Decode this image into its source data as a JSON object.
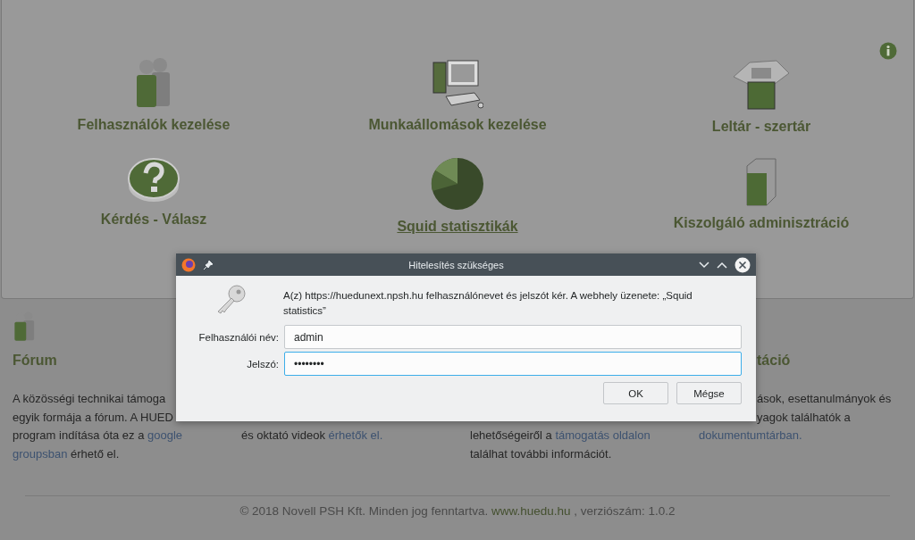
{
  "tiles": [
    {
      "label": "Felhasználók kezelése",
      "kind": "users",
      "underlined": false
    },
    {
      "label": "Munkaállomások kezelése",
      "kind": "computer",
      "underlined": false
    },
    {
      "label": "Leltár - szertár",
      "kind": "box",
      "underlined": false
    },
    {
      "label": "Kérdés - Válasz",
      "kind": "question",
      "underlined": false
    },
    {
      "label": "Squid statisztikák",
      "kind": "pie",
      "underlined": true
    },
    {
      "label": "Kiszolgáló adminisztráció",
      "kind": "server",
      "underlined": false
    }
  ],
  "sections": [
    {
      "title": "Fórum",
      "title_clipped": false,
      "kind": "users",
      "lines": [
        {
          "clipped_start": false,
          "segments": [
            {
              "text": "A közösségi technikai támoga",
              "link": false
            }
          ]
        },
        {
          "clipped_start": false,
          "segments": [
            {
              "text": "egyik formája a fórum. A HUED",
              "link": false
            }
          ]
        },
        {
          "clipped_start": false,
          "segments": [
            {
              "text": "program indítása óta ez a ",
              "link": false
            },
            {
              "text": "google",
              "link": true
            }
          ]
        },
        {
          "clipped_start": false,
          "segments": [
            {
              "text": "groupsban",
              "link": true
            },
            {
              "text": " érhető el.",
              "link": false
            }
          ]
        }
      ]
    },
    {
      "lines": [
        {
          "segments": [
            {
              "text": "és oktató videok ",
              "link": false
            },
            {
              "text": "érhetők el.",
              "link": true
            }
          ]
        }
      ]
    },
    {
      "lines": [
        {
          "segments": [
            {
              "text": "lehetőségeiről a ",
              "link": false
            },
            {
              "text": "támogatás oldalon",
              "link": true
            }
          ]
        },
        {
          "segments": [
            {
              "text": "találhat további információt.",
              "link": false
            }
          ]
        }
      ]
    },
    {
      "title": "táció",
      "title_clipped": true,
      "lines": [
        {
          "clipped_start": true,
          "segments": [
            {
              "text": "ások, esettanulmányok és",
              "link": false
            }
          ]
        },
        {
          "clipped_start": true,
          "segments": [
            {
              "text": "yagok találhatók a",
              "link": false
            }
          ]
        },
        {
          "clipped_start": false,
          "segments": [
            {
              "text": "dokumentumtárban.",
              "link": true
            }
          ]
        }
      ]
    }
  ],
  "footer": {
    "text": "© 2018 Novell PSH Kft. Minden jog fenntartva. ",
    "link": "www.huedu.hu",
    "suffix": " , verziószám: 1.0.2"
  },
  "dialog": {
    "title": "Hitelesítés szükséges",
    "message": "A(z) https://huedunext.npsh.hu felhasználónevet és jelszót kér. A webhely üzenete: „Squid statistics”",
    "fields": [
      {
        "label": "Felhasználói név:",
        "value": "admin",
        "focused": false
      },
      {
        "label": "Jelszó:",
        "value": "••••••••",
        "focused": true
      }
    ],
    "buttons": [
      "OK",
      "Mégse"
    ]
  }
}
